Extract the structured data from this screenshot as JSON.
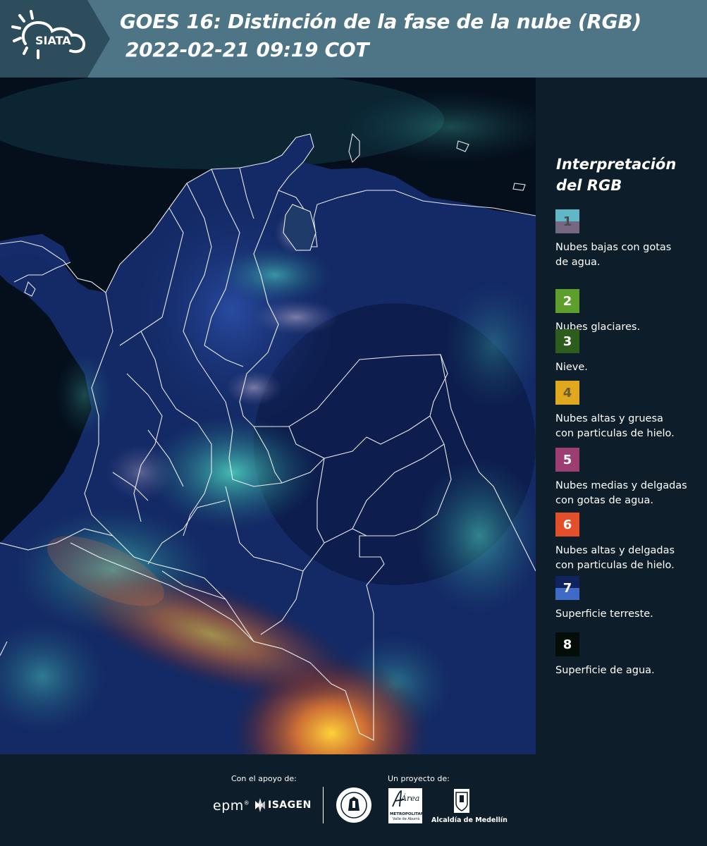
{
  "header": {
    "logo_text": "SIATA",
    "title_line1": "GOES 16: Distinción de la fase de la nube (RGB)",
    "title_line2": "2022-02-21 09:19 COT"
  },
  "legend": {
    "title_line1": "Interpretación",
    "title_line2": "del RGB",
    "items": [
      {
        "number": "1",
        "label_line1": "Nubes bajas con gotas",
        "label_line2": "de agua.",
        "color_top": "#62b7c6",
        "color_bottom": "#766883",
        "text_color": "#4a4a55"
      },
      {
        "number": "2",
        "label_line1": "Nubes glaciares.",
        "label_line2": "",
        "color_top": "#5e9e2c",
        "color_bottom": "#5e9e2c",
        "text_color": "#ffffff"
      },
      {
        "number": "3",
        "label_line1": "Nieve.",
        "label_line2": "",
        "color_top": "#2c5d1d",
        "color_bottom": "#2c5d1d",
        "text_color": "#ffffff"
      },
      {
        "number": "4",
        "label_line1": "Nubes altas y gruesa",
        "label_line2": "con particulas de hielo.",
        "color_top": "#e0a81f",
        "color_bottom": "#e0a81f",
        "text_color": "#6b5a2a"
      },
      {
        "number": "5",
        "label_line1": "Nubes medias y delgadas",
        "label_line2": "con gotas de agua.",
        "color_top": "#9c3e72",
        "color_bottom": "#9c3e72",
        "text_color": "#ffffff"
      },
      {
        "number": "6",
        "label_line1": "Nubes altas y delgadas",
        "label_line2": "con particulas de hielo.",
        "color_top": "#e1502a",
        "color_bottom": "#e1502a",
        "text_color": "#ffffff"
      },
      {
        "number": "7",
        "label_line1": "Superficie terreste.",
        "label_line2": "",
        "color_top": "#10235e",
        "color_bottom": "#3f6bc8",
        "text_color": "#ffffff"
      },
      {
        "number": "8",
        "label_line1": "Superficie de agua.",
        "label_line2": "",
        "color_top": "#050d08",
        "color_bottom": "#050d08",
        "text_color": "#ffffff"
      }
    ]
  },
  "footer": {
    "support_caption": "Con el apoyo de:",
    "project_caption": "Un proyecto de:",
    "sponsor_epm": "epm",
    "sponsor_isagen": "ISAGEN",
    "area_metropolitana_text": "Área",
    "area_metropolitana_sub": "METROPOLITANA",
    "area_metropolitana_sub2": "Valle de Aburrá",
    "alcaldia_text": "Alcaldía de Medellín"
  },
  "colors": {
    "header_bg": "#4e7585",
    "logo_plate": "#2d4d5c",
    "page_bg": "#0d1e2a",
    "land": "#142a66",
    "ocean": "#050f1c",
    "border_lines": "#ffffff"
  }
}
